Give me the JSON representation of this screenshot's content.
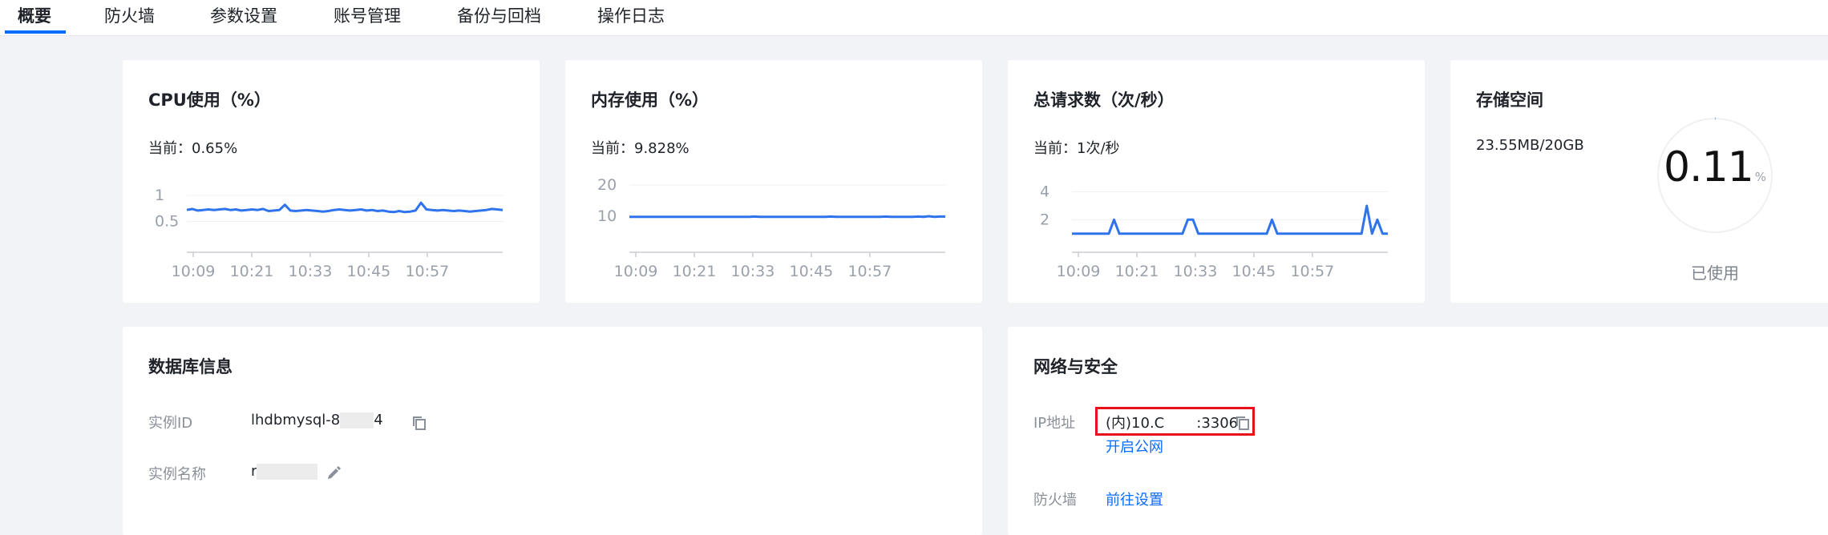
{
  "tabs": [
    {
      "label": "概要",
      "active": true
    },
    {
      "label": "防火墙"
    },
    {
      "label": "参数设置"
    },
    {
      "label": "账号管理"
    },
    {
      "label": "备份与回档"
    },
    {
      "label": "操作日志"
    }
  ],
  "colors": {
    "accent": "#0a6cff",
    "line": "#2f74ec",
    "highlight_box": "#e8101a"
  },
  "monitors": {
    "cpu": {
      "title": "CPU使用（%）",
      "current": "当前：0.65%",
      "chart_data": {
        "type": "line",
        "x_ticks": [
          "10:09",
          "10:21",
          "10:33",
          "10:45",
          "10:57"
        ],
        "y_ticks": [
          "1",
          "0.5"
        ],
        "ylim": [
          0,
          1.2
        ],
        "series": [
          {
            "values": [
              0.72,
              0.74,
              0.71,
              0.72,
              0.73,
              0.72,
              0.73,
              0.74,
              0.72,
              0.73,
              0.71,
              0.72,
              0.73,
              0.72,
              0.74,
              0.7,
              0.71,
              0.72,
              0.82,
              0.71,
              0.7,
              0.71,
              0.72,
              0.71,
              0.7,
              0.69,
              0.7,
              0.72,
              0.73,
              0.72,
              0.71,
              0.72,
              0.73,
              0.71,
              0.72,
              0.7,
              0.71,
              0.69,
              0.68,
              0.7,
              0.68,
              0.69,
              0.71,
              0.86,
              0.73,
              0.72,
              0.71,
              0.72,
              0.71,
              0.7,
              0.71,
              0.7,
              0.69,
              0.7,
              0.71,
              0.72,
              0.74,
              0.73,
              0.72
            ]
          }
        ]
      }
    },
    "memory": {
      "title": "内存使用（%）",
      "current": "当前：9.828%",
      "chart_data": {
        "type": "line",
        "x_ticks": [
          "10:09",
          "10:21",
          "10:33",
          "10:45",
          "10:57"
        ],
        "y_ticks": [
          "20",
          "10"
        ],
        "ylim": [
          0,
          20
        ],
        "series": [
          {
            "values": [
              9.8,
              9.8,
              9.8,
              9.8,
              9.8,
              9.8,
              9.8,
              9.8,
              9.8,
              9.8,
              9.8,
              9.8,
              9.8,
              9.8,
              9.8,
              9.8,
              9.8,
              9.8,
              9.8,
              9.8,
              9.8,
              9.8,
              9.8,
              9.9,
              9.8,
              9.8,
              9.8,
              9.8,
              9.8,
              9.8,
              9.8,
              9.8,
              9.8,
              9.8,
              9.8,
              9.8,
              9.8,
              9.9,
              9.8,
              9.8,
              9.8,
              9.8,
              9.8,
              9.8,
              9.8,
              9.8,
              9.8,
              9.9,
              9.8,
              9.8,
              9.8,
              9.8,
              9.8,
              9.9,
              9.8,
              10.0,
              9.8,
              9.9,
              9.9
            ]
          }
        ]
      }
    },
    "requests": {
      "title": "总请求数（次/秒）",
      "current": "当前：1次/秒",
      "chart_data": {
        "type": "line",
        "x_ticks": [
          "10:09",
          "10:21",
          "10:33",
          "10:45",
          "10:57"
        ],
        "y_ticks": [
          "4",
          "2"
        ],
        "ylim": [
          0,
          4.5
        ],
        "series": [
          {
            "values": [
              1,
              1,
              1,
              1,
              1,
              1,
              1,
              1,
              2,
              1,
              1,
              1,
              1,
              1,
              1,
              1,
              1,
              1,
              1,
              1,
              1,
              1,
              2,
              2,
              1,
              1,
              1,
              1,
              1,
              1,
              1,
              1,
              1,
              1,
              1,
              1,
              1,
              1,
              2,
              1,
              1,
              1,
              1,
              1,
              1,
              1,
              1,
              1,
              1,
              1,
              1,
              1,
              1,
              1,
              1,
              1,
              3,
              1,
              2,
              1,
              1
            ]
          }
        ]
      }
    },
    "storage": {
      "title": "存储空间",
      "usage": "23.55MB/20GB",
      "percent_value": "0.11",
      "percent_unit": "%",
      "percent_fraction": 0.0011,
      "caption": "已使用"
    }
  },
  "db_info": {
    "title": "数据库信息",
    "instance_id_label": "实例ID",
    "instance_id_prefix": "lhdbmysql-8",
    "instance_id_suffix": "4",
    "instance_name_label": "实例名称",
    "instance_name_prefix": "r"
  },
  "network": {
    "title": "网络与安全",
    "ip_label": "IP地址",
    "ip_prefix": "(内)10.C",
    "ip_port": ":3306",
    "public_link": "开启公网",
    "firewall_label": "防火墙",
    "firewall_link": "前往设置"
  }
}
